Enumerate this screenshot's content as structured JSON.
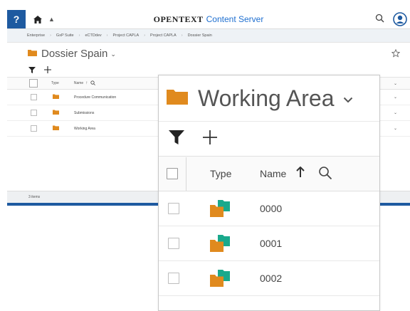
{
  "app": {
    "help_label": "?",
    "brand_name": "OPENTEXT",
    "brand_product": "Content Server"
  },
  "breadcrumb": [
    "Enterprise",
    "GxP Suite",
    "eCTDdev",
    "Project CAPLA",
    "Project CAPLA",
    "Dossier Spain"
  ],
  "background_view": {
    "title": "Dossier Spain",
    "columns": {
      "type": "Type",
      "name": "Name"
    },
    "rows": [
      {
        "name": "Procedure Communication"
      },
      {
        "name": "Submissions"
      },
      {
        "name": "Working Area"
      }
    ],
    "footer": "3 items"
  },
  "zoom_view": {
    "title": "Working Area",
    "columns": {
      "type": "Type",
      "name": "Name"
    },
    "rows": [
      {
        "name": "0000"
      },
      {
        "name": "0001"
      },
      {
        "name": "0002"
      }
    ]
  },
  "colors": {
    "accent": "#1e5aa0",
    "folder": "#e08a1e",
    "compound_green": "#1aa98c",
    "link_blue": "#1e6fd0"
  }
}
